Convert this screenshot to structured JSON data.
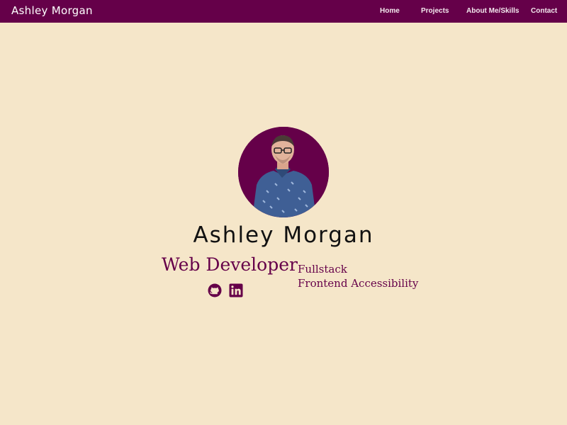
{
  "header": {
    "brand": "Ashley Morgan",
    "nav": {
      "home": "Home",
      "projects": "Projects",
      "about": "About Me/Skills",
      "contact": "Contact"
    }
  },
  "hero": {
    "name": "Ashley Morgan",
    "role": "Web Developer",
    "specialties": [
      "Fullstack",
      "Frontend Accessibility"
    ],
    "social": {
      "icons": [
        "github-icon",
        "linkedin-icon"
      ]
    }
  },
  "colors": {
    "accent": "#650049",
    "background": "#f5e6c9",
    "text": "#111111"
  }
}
